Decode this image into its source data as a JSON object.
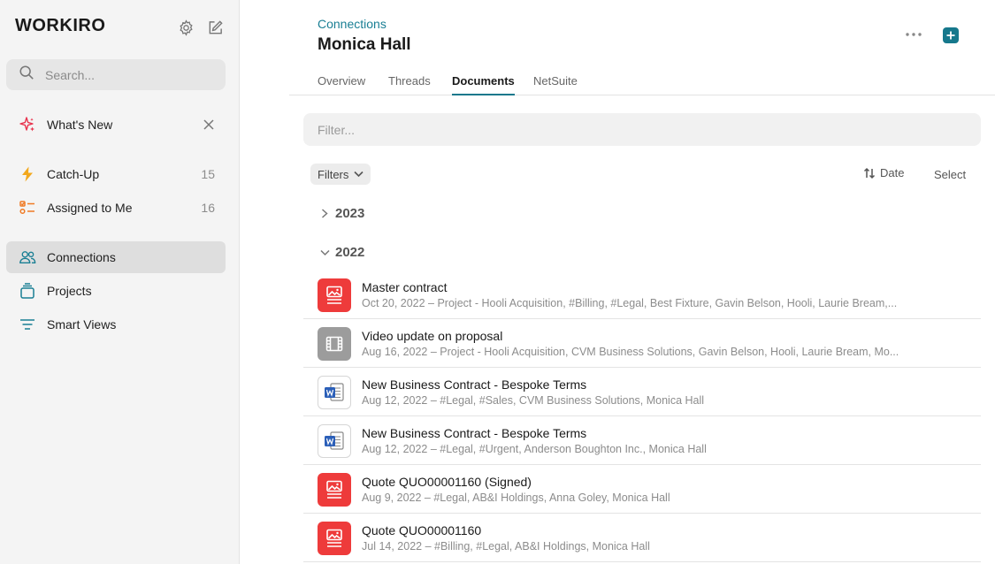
{
  "sidebar": {
    "logo": "WORKIRO",
    "search_placeholder": "Search...",
    "whats_new": "What's New",
    "items": [
      {
        "label": "Catch-Up",
        "count": "15"
      },
      {
        "label": "Assigned to Me",
        "count": "16"
      },
      {
        "label": "Connections"
      },
      {
        "label": "Projects"
      },
      {
        "label": "Smart Views"
      }
    ]
  },
  "header": {
    "breadcrumb": "Connections",
    "title": "Monica Hall"
  },
  "tabs": [
    "Overview",
    "Threads",
    "Documents",
    "NetSuite"
  ],
  "active_tab": "Documents",
  "filter_placeholder": "Filter...",
  "toolbar": {
    "filters_label": "Filters",
    "sort_label": "Date",
    "select_label": "Select"
  },
  "groups": [
    {
      "year": "2023",
      "expanded": false
    },
    {
      "year": "2022",
      "expanded": true
    }
  ],
  "colors": {
    "accent": "#16788c",
    "pdf_icon": "#ee3b3b",
    "video_icon": "#9c9c9c",
    "word_blue": "#2b5fb8"
  },
  "documents": [
    {
      "title": "Master contract",
      "meta": "Oct 20, 2022 – Project - Hooli Acquisition, #Billing, #Legal, Best Fixture, Gavin Belson, Hooli, Laurie Bream,...",
      "icon": "image-doc-icon"
    },
    {
      "title": "Video update on proposal",
      "meta": "Aug 16, 2022 – Project - Hooli Acquisition, CVM Business Solutions, Gavin Belson, Hooli, Laurie Bream, Mo...",
      "icon": "video-icon"
    },
    {
      "title": "New Business Contract - Bespoke Terms",
      "meta": "Aug 12, 2022 – #Legal, #Sales, CVM Business Solutions, Monica Hall",
      "icon": "word-doc-icon"
    },
    {
      "title": "New Business Contract - Bespoke Terms",
      "meta": "Aug 12, 2022 – #Legal, #Urgent, Anderson Boughton Inc., Monica Hall",
      "icon": "word-doc-icon"
    },
    {
      "title": "Quote QUO00001160 (Signed)",
      "meta": "Aug 9, 2022 – #Legal, AB&I Holdings, Anna Goley, Monica Hall",
      "icon": "image-doc-icon"
    },
    {
      "title": "Quote QUO00001160",
      "meta": "Jul 14, 2022 – #Billing, #Legal, AB&I Holdings, Monica Hall",
      "icon": "image-doc-icon"
    }
  ]
}
